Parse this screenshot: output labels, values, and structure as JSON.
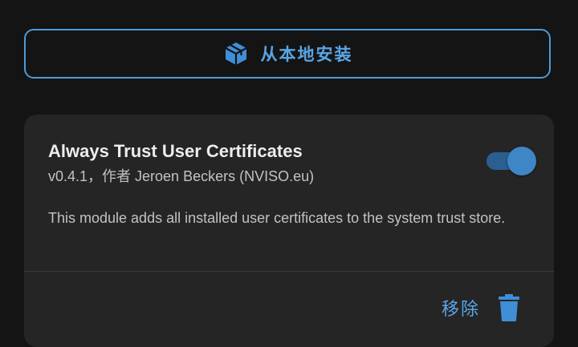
{
  "install": {
    "label": "从本地安装",
    "icon": "package-box-icon"
  },
  "module": {
    "title": "Always Trust User Certificates",
    "subtitle": "v0.4.1，作者 Jeroen Beckers (NVISO.eu)",
    "description": "This module adds all installed user certificates to the system trust store.",
    "enabled": true,
    "remove_label": "移除",
    "remove_icon": "trash-icon"
  },
  "colors": {
    "accent": "#5aa5e6",
    "background": "#141414",
    "card": "#252526"
  }
}
